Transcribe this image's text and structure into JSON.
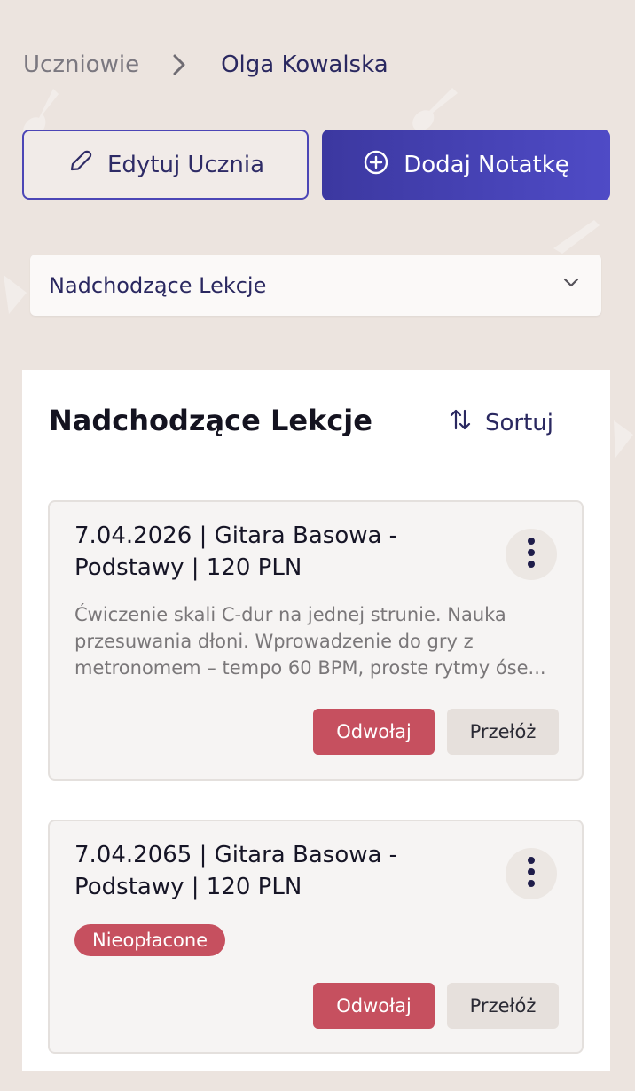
{
  "breadcrumb": {
    "parent": "Uczniowie",
    "current": "Olga Kowalska"
  },
  "actions": {
    "edit_label": "Edytuj Ucznia",
    "add_note_label": "Dodaj Notatkę"
  },
  "filter": {
    "selected": "Nadchodzące Lekcje"
  },
  "lessons": {
    "title": "Nadchodzące Lekcje",
    "sort_label": "Sortuj",
    "items": [
      {
        "title": "7.04.2026 | Gitara Basowa - Podstawy | 120 PLN",
        "description": "Ćwiczenie skali C-dur na jednej strunie. Nauka przesuwania dłoni. Wprowadzenie do gry z metronomem – tempo 60 BPM, proste rytmy óse...",
        "cancel_label": "Odwołaj",
        "reschedule_label": "Przełóż"
      },
      {
        "title": "7.04.2065 | Gitara Basowa - Podstawy | 120 PLN",
        "badge": "Nieopłacone",
        "cancel_label": "Odwołaj",
        "reschedule_label": "Przełóż"
      }
    ]
  },
  "colors": {
    "background": "#ece4df",
    "accent": "#4c46b6",
    "danger": "#c6505f"
  }
}
